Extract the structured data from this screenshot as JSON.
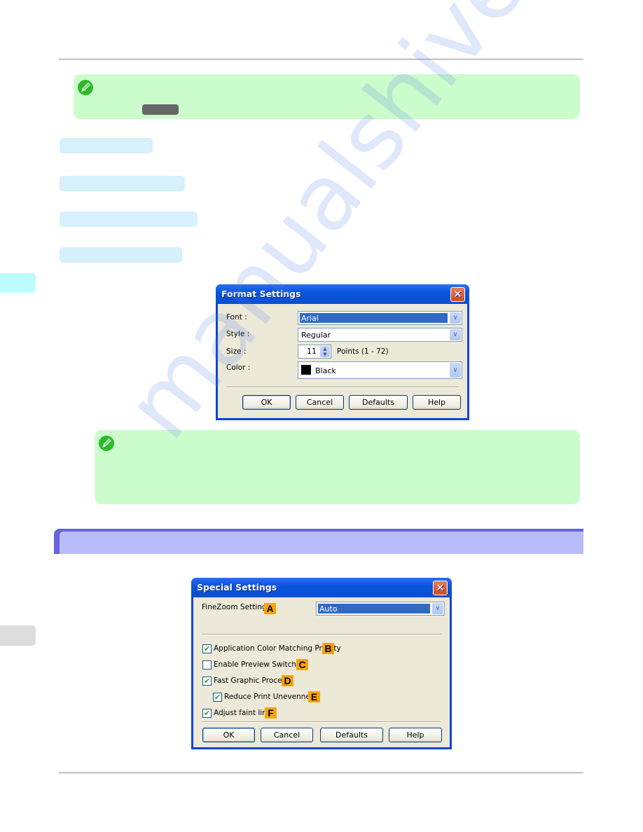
{
  "page": {
    "watermark": "manualshive.com",
    "colors": {
      "note_bg": "#ccfccc",
      "pill_bg": "#d6f0fc",
      "section_bar": "#6464e0",
      "section_bar_fill": "#b8bcfa",
      "side_tab_active": "#bcfcfc",
      "side_tab_inactive": "#dcdcdc",
      "badge": "#f7a400"
    }
  },
  "note_icon": "pencil-note-icon",
  "format_settings": {
    "title": "Format Settings",
    "close_glyph": "✕",
    "font_label": "Font :",
    "font_value": "Arial",
    "style_label": "Style :",
    "style_value": "Regular",
    "size_label": "Size :",
    "size_value": "11",
    "size_range": "Points (1 - 72)",
    "color_label": "Color :",
    "color_value": "Black",
    "buttons": {
      "ok": "OK",
      "cancel": "Cancel",
      "defaults": "Defaults",
      "help": "Help"
    }
  },
  "special_settings": {
    "title": "Special Settings",
    "close_glyph": "✕",
    "finezoom_label": "FineZoom Settings :",
    "finezoom_badge": "A",
    "finezoom_value": "Auto",
    "options": [
      {
        "label": "Application Color Matching Priority",
        "badge": "B",
        "checked": true
      },
      {
        "label": "Enable Preview Switching",
        "badge": "C",
        "checked": false
      },
      {
        "label": "Fast Graphic Process",
        "badge": "D",
        "checked": true
      },
      {
        "label": "Reduce Print Unevenness",
        "badge": "E",
        "checked": true
      },
      {
        "label": "Adjust faint lines",
        "badge": "F",
        "checked": true
      }
    ],
    "buttons": {
      "ok": "OK",
      "cancel": "Cancel",
      "defaults": "Defaults",
      "help": "Help"
    }
  }
}
